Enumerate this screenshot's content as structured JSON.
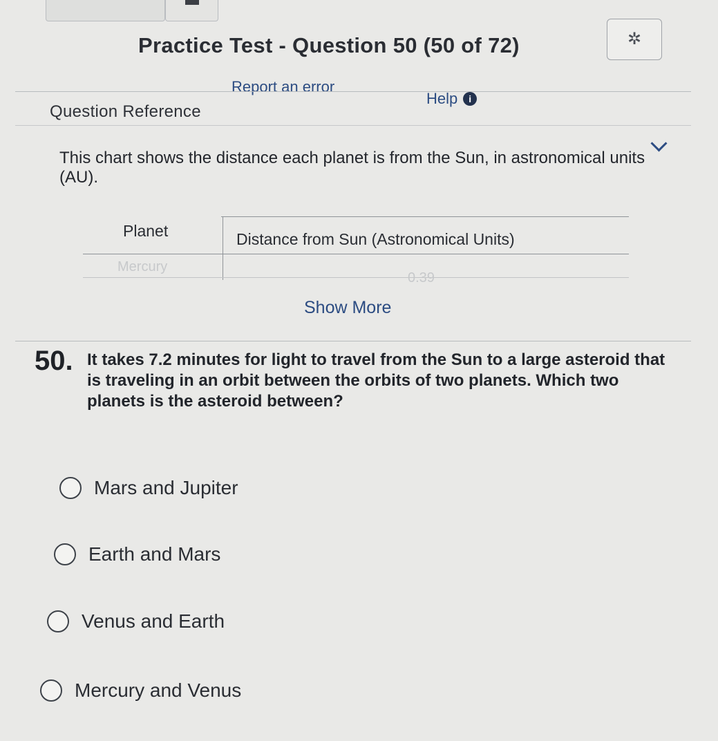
{
  "settings": {
    "icon": "gear-icon"
  },
  "header": {
    "title": "Practice Test - Question 50 (50 of 72)",
    "report_label": "Report an error",
    "help_label": "Help",
    "info_glyph": "i"
  },
  "reference": {
    "header": "Question Reference",
    "intro": "This chart shows the distance each planet is from the Sun, in astronomical units (AU).",
    "table": {
      "columns": [
        "Planet",
        "Distance from Sun (Astronomical Units)"
      ],
      "first_row_faded": [
        "Mercury",
        "0.39"
      ]
    },
    "show_more_label": "Show More"
  },
  "question": {
    "number": "50.",
    "text": "It takes 7.2 minutes for light to travel from the Sun to a large asteroid that is traveling in an orbit between the orbits of two planets. Which two planets is the asteroid between?",
    "options": [
      "Mars and Jupiter",
      "Earth and Mars",
      "Venus and Earth",
      "Mercury and Venus"
    ]
  }
}
